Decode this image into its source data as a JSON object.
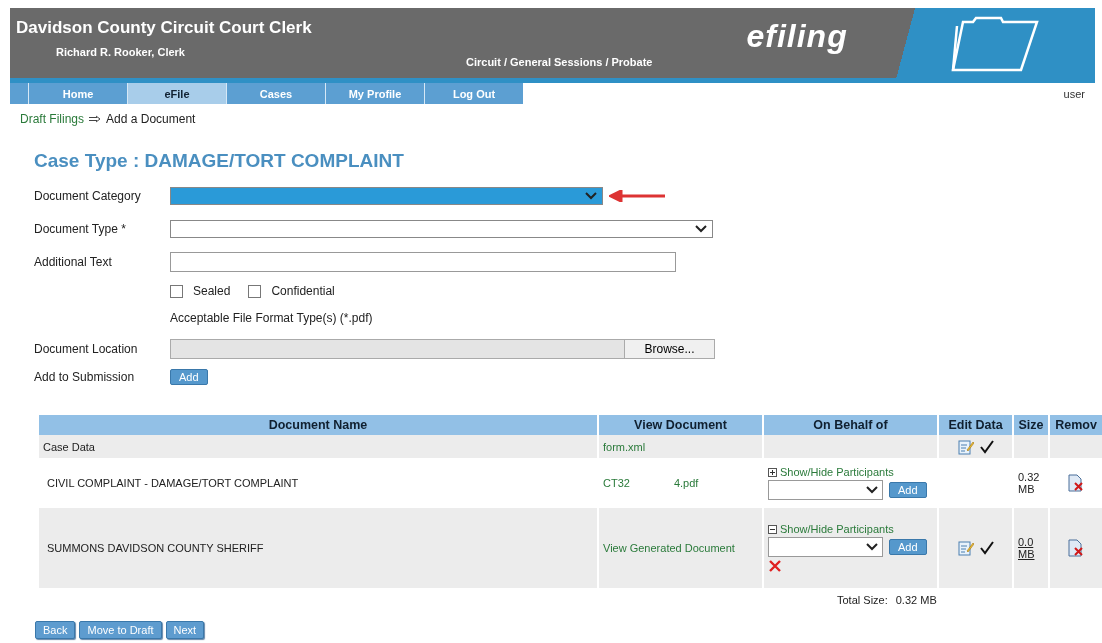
{
  "header": {
    "title": "Davidson County Circuit Court Clerk",
    "subtitle": "Richard R. Rooker, Clerk",
    "courts": "Circuit / General Sessions / Probate",
    "brand": "efiling"
  },
  "nav": [
    {
      "label": "Home",
      "selected": false
    },
    {
      "label": "eFile",
      "selected": true
    },
    {
      "label": "Cases",
      "selected": false
    },
    {
      "label": "My Profile",
      "selected": false
    },
    {
      "label": "Log Out",
      "selected": false
    }
  ],
  "user_label": "user",
  "breadcrumb": [
    {
      "label": "Draft Filings",
      "link": true
    },
    {
      "label": "Add a Document",
      "link": false
    }
  ],
  "heading": "Case Type : DAMAGE/TORT COMPLAINT",
  "form": {
    "fields": [
      {
        "kind": "select",
        "label": "Document Category",
        "focused": true,
        "pointer_arrow": true
      },
      {
        "kind": "select",
        "label": "Document Type *",
        "focused": false,
        "pointer_arrow": false
      },
      {
        "kind": "text",
        "label": "Additional Text"
      }
    ],
    "checkboxes": [
      {
        "label": "Sealed",
        "checked": false
      },
      {
        "label": "Confidential",
        "checked": false
      }
    ],
    "format_note": "Acceptable File Format Type(s) (*.pdf)",
    "location_label": "Document Location",
    "browse_button": "Browse...",
    "submission_label": "Add to Submission",
    "add_button": "Add"
  },
  "table": {
    "columns": [
      "Document Name",
      "View Document",
      "On Behalf of",
      "Edit Data",
      "Size",
      "Remov"
    ],
    "rows": [
      {
        "name": "Case Data",
        "view": [
          "form.xml"
        ],
        "edit_data": true,
        "removable": false
      },
      {
        "name": "CIVIL COMPLAINT - DAMAGE/TORT COMPLAINT",
        "view": [
          "CT32",
          "4.pdf"
        ],
        "participants": {
          "toggle": "Show/Hide Participants",
          "expanded": false,
          "add_button": "Add",
          "listed": false
        },
        "edit_data": false,
        "size": "0.32 MB",
        "size_link": false,
        "removable": true
      },
      {
        "name": "SUMMONS DAVIDSON COUNTY SHERIFF",
        "view": [
          "View Generated Document"
        ],
        "participants": {
          "toggle": "Show/Hide Participants",
          "expanded": true,
          "add_button": "Add",
          "listed": true
        },
        "edit_data": true,
        "size": "0.0 MB",
        "size_link": true,
        "removable": true
      }
    ],
    "total_label": "Total Size:",
    "total_value": "0.32 MB"
  },
  "buttons": [
    "Back",
    "Move to Draft",
    "Next"
  ]
}
